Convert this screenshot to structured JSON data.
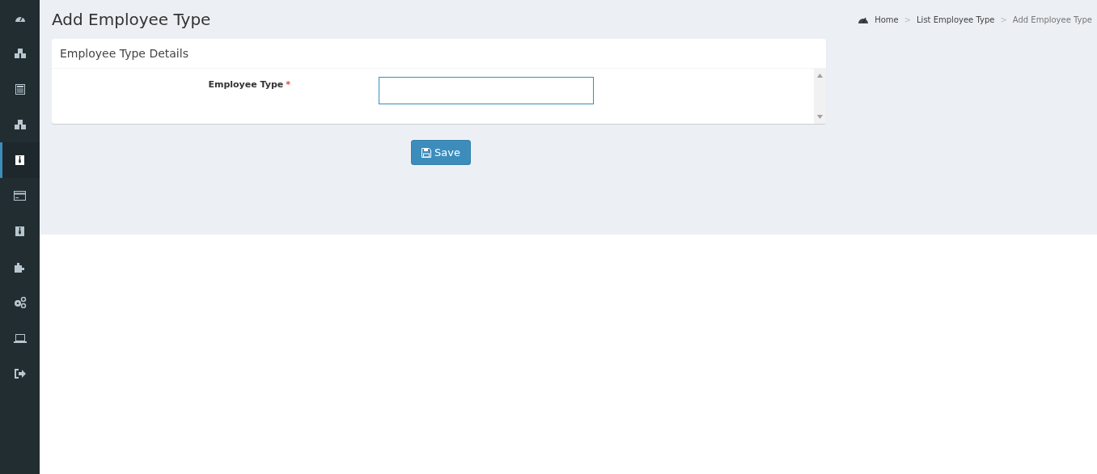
{
  "sidebar": {
    "items": [
      {
        "kind": "dashboard",
        "selected": false
      },
      {
        "kind": "cubes",
        "selected": false
      },
      {
        "kind": "calculator",
        "selected": false
      },
      {
        "kind": "cubes",
        "selected": false
      },
      {
        "kind": "tie",
        "selected": true
      },
      {
        "kind": "card",
        "selected": false
      },
      {
        "kind": "tie",
        "selected": false
      },
      {
        "kind": "puzzle",
        "selected": false
      },
      {
        "kind": "cogs",
        "selected": false
      },
      {
        "kind": "laptop",
        "selected": false
      },
      {
        "kind": "signout",
        "selected": false
      }
    ]
  },
  "page_title": "Add Employee Type",
  "breadcrumb": [
    {
      "label": "Home"
    },
    {
      "label": "List Employee Type"
    },
    {
      "label": "Add Employee Type"
    }
  ],
  "breadcrumb_separator": ">",
  "card": {
    "title": "Employee Type Details",
    "fields": [
      {
        "label": "Employee Type",
        "required_mark": "*"
      }
    ]
  },
  "save_button": {
    "label": "Save"
  }
}
